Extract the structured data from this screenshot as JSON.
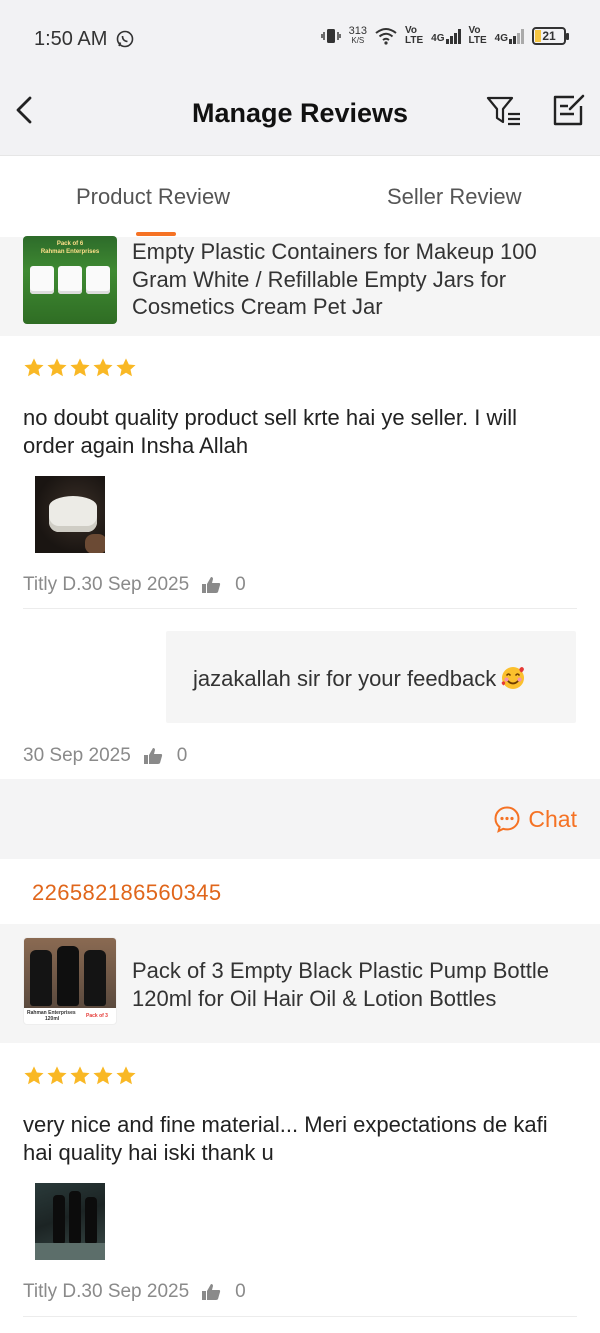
{
  "status_bar": {
    "time": "1:50 AM",
    "net_speed": "313",
    "net_unit": "K/S",
    "lte1": [
      "Vo",
      "LTE"
    ],
    "net_4g_1": "4G",
    "lte2": [
      "Vo",
      "LTE"
    ],
    "net_4g_2": "4G",
    "battery": "21",
    "icons": [
      "whatsapp-icon",
      "vibrate-icon",
      "wifi-icon",
      "signal-icon",
      "battery-icon"
    ]
  },
  "header": {
    "title": "Manage Reviews",
    "icons": [
      "back-icon",
      "filter-icon",
      "edit-icon"
    ]
  },
  "tabs": [
    {
      "label": "Product Review",
      "active": true
    },
    {
      "label": "Seller Review",
      "active": false
    }
  ],
  "accent_color": "#f57224",
  "reviews": [
    {
      "product": {
        "name": "Empty Plastic Containers for Makeup 100 Gram White / Refillable Empty Jars for Cosmetics Cream Pet Jar",
        "thumb_caption_1": "Pack of 6",
        "thumb_caption_2": "Rahman Enterprises"
      },
      "rating": 5,
      "text": "no doubt quality product sell krte hai ye seller. I will order again Insha Allah",
      "author_date": "Titly D.30 Sep 2025",
      "likes": "0",
      "reply": {
        "text": "jazakallah sir for your feedback",
        "date": "30 Sep 2025",
        "likes": "0"
      },
      "chat_label": "Chat"
    },
    {
      "order_id": "226582186560345",
      "product": {
        "name": "Pack of 3 Empty Black Plastic Pump Bottle 120ml for Oil Hair Oil & Lotion Bottles",
        "thumb_caption_1": "Rahman Enterprises",
        "thumb_caption_2": "120ml",
        "thumb_caption_3": "Pack of 3"
      },
      "rating": 5,
      "text": "very nice and fine material... Meri expectations de kafi hai quality hai iski thank u",
      "author_date": "Titly D.30 Sep 2025",
      "likes": "0"
    }
  ]
}
